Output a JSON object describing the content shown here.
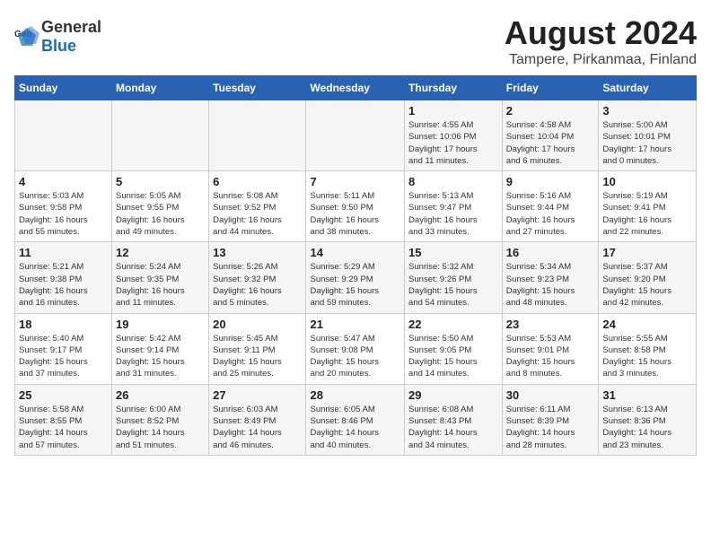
{
  "header": {
    "logo_general": "General",
    "logo_blue": "Blue",
    "title": "August 2024",
    "subtitle": "Tampere, Pirkanmaa, Finland"
  },
  "columns": [
    "Sunday",
    "Monday",
    "Tuesday",
    "Wednesday",
    "Thursday",
    "Friday",
    "Saturday"
  ],
  "weeks": [
    {
      "days": [
        {
          "num": "",
          "detail": ""
        },
        {
          "num": "",
          "detail": ""
        },
        {
          "num": "",
          "detail": ""
        },
        {
          "num": "",
          "detail": ""
        },
        {
          "num": "1",
          "detail": "Sunrise: 4:55 AM\nSunset: 10:06 PM\nDaylight: 17 hours\nand 11 minutes."
        },
        {
          "num": "2",
          "detail": "Sunrise: 4:58 AM\nSunset: 10:04 PM\nDaylight: 17 hours\nand 6 minutes."
        },
        {
          "num": "3",
          "detail": "Sunrise: 5:00 AM\nSunset: 10:01 PM\nDaylight: 17 hours\nand 0 minutes."
        }
      ]
    },
    {
      "days": [
        {
          "num": "4",
          "detail": "Sunrise: 5:03 AM\nSunset: 9:58 PM\nDaylight: 16 hours\nand 55 minutes."
        },
        {
          "num": "5",
          "detail": "Sunrise: 5:05 AM\nSunset: 9:55 PM\nDaylight: 16 hours\nand 49 minutes."
        },
        {
          "num": "6",
          "detail": "Sunrise: 5:08 AM\nSunset: 9:52 PM\nDaylight: 16 hours\nand 44 minutes."
        },
        {
          "num": "7",
          "detail": "Sunrise: 5:11 AM\nSunset: 9:50 PM\nDaylight: 16 hours\nand 38 minutes."
        },
        {
          "num": "8",
          "detail": "Sunrise: 5:13 AM\nSunset: 9:47 PM\nDaylight: 16 hours\nand 33 minutes."
        },
        {
          "num": "9",
          "detail": "Sunrise: 5:16 AM\nSunset: 9:44 PM\nDaylight: 16 hours\nand 27 minutes."
        },
        {
          "num": "10",
          "detail": "Sunrise: 5:19 AM\nSunset: 9:41 PM\nDaylight: 16 hours\nand 22 minutes."
        }
      ]
    },
    {
      "days": [
        {
          "num": "11",
          "detail": "Sunrise: 5:21 AM\nSunset: 9:38 PM\nDaylight: 16 hours\nand 16 minutes."
        },
        {
          "num": "12",
          "detail": "Sunrise: 5:24 AM\nSunset: 9:35 PM\nDaylight: 16 hours\nand 11 minutes."
        },
        {
          "num": "13",
          "detail": "Sunrise: 5:26 AM\nSunset: 9:32 PM\nDaylight: 16 hours\nand 5 minutes."
        },
        {
          "num": "14",
          "detail": "Sunrise: 5:29 AM\nSunset: 9:29 PM\nDaylight: 15 hours\nand 59 minutes."
        },
        {
          "num": "15",
          "detail": "Sunrise: 5:32 AM\nSunset: 9:26 PM\nDaylight: 15 hours\nand 54 minutes."
        },
        {
          "num": "16",
          "detail": "Sunrise: 5:34 AM\nSunset: 9:23 PM\nDaylight: 15 hours\nand 48 minutes."
        },
        {
          "num": "17",
          "detail": "Sunrise: 5:37 AM\nSunset: 9:20 PM\nDaylight: 15 hours\nand 42 minutes."
        }
      ]
    },
    {
      "days": [
        {
          "num": "18",
          "detail": "Sunrise: 5:40 AM\nSunset: 9:17 PM\nDaylight: 15 hours\nand 37 minutes."
        },
        {
          "num": "19",
          "detail": "Sunrise: 5:42 AM\nSunset: 9:14 PM\nDaylight: 15 hours\nand 31 minutes."
        },
        {
          "num": "20",
          "detail": "Sunrise: 5:45 AM\nSunset: 9:11 PM\nDaylight: 15 hours\nand 25 minutes."
        },
        {
          "num": "21",
          "detail": "Sunrise: 5:47 AM\nSunset: 9:08 PM\nDaylight: 15 hours\nand 20 minutes."
        },
        {
          "num": "22",
          "detail": "Sunrise: 5:50 AM\nSunset: 9:05 PM\nDaylight: 15 hours\nand 14 minutes."
        },
        {
          "num": "23",
          "detail": "Sunrise: 5:53 AM\nSunset: 9:01 PM\nDaylight: 15 hours\nand 8 minutes."
        },
        {
          "num": "24",
          "detail": "Sunrise: 5:55 AM\nSunset: 8:58 PM\nDaylight: 15 hours\nand 3 minutes."
        }
      ]
    },
    {
      "days": [
        {
          "num": "25",
          "detail": "Sunrise: 5:58 AM\nSunset: 8:55 PM\nDaylight: 14 hours\nand 57 minutes."
        },
        {
          "num": "26",
          "detail": "Sunrise: 6:00 AM\nSunset: 8:52 PM\nDaylight: 14 hours\nand 51 minutes."
        },
        {
          "num": "27",
          "detail": "Sunrise: 6:03 AM\nSunset: 8:49 PM\nDaylight: 14 hours\nand 46 minutes."
        },
        {
          "num": "28",
          "detail": "Sunrise: 6:05 AM\nSunset: 8:46 PM\nDaylight: 14 hours\nand 40 minutes."
        },
        {
          "num": "29",
          "detail": "Sunrise: 6:08 AM\nSunset: 8:43 PM\nDaylight: 14 hours\nand 34 minutes."
        },
        {
          "num": "30",
          "detail": "Sunrise: 6:11 AM\nSunset: 8:39 PM\nDaylight: 14 hours\nand 28 minutes."
        },
        {
          "num": "31",
          "detail": "Sunrise: 6:13 AM\nSunset: 8:36 PM\nDaylight: 14 hours\nand 23 minutes."
        }
      ]
    }
  ]
}
